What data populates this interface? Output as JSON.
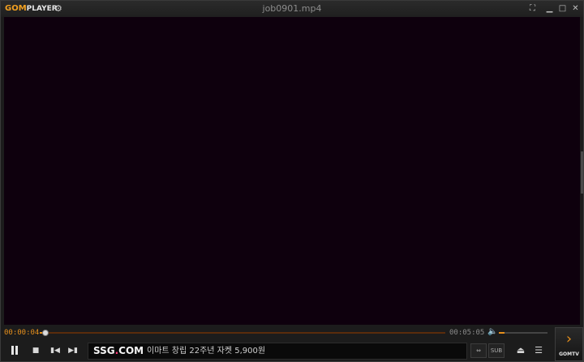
{
  "app": {
    "logo_gom": "GOM",
    "logo_player": "PLAYER",
    "title": "job0901.mp4"
  },
  "window_controls": {
    "fullscreen_icon": "fullscreen-icon",
    "minimize_icon": "minimize-icon",
    "maximize_icon": "maximize-icon",
    "close_icon": "close-icon"
  },
  "playback": {
    "current_time": "00:00:04",
    "total_time": "00:05:05",
    "progress": 0.013,
    "volume": 0.12
  },
  "ad": {
    "brand_a": "SSG",
    "brand_dot": ".",
    "brand_b": "COM",
    "text": "이마트 창립 22주년 자켓 5,900원"
  },
  "buttons": {
    "sub_label": "SUB"
  },
  "gomtv": {
    "label": "GOMTV"
  },
  "colors": {
    "accent": "#e7901c",
    "video_bg": "#0e000d"
  }
}
